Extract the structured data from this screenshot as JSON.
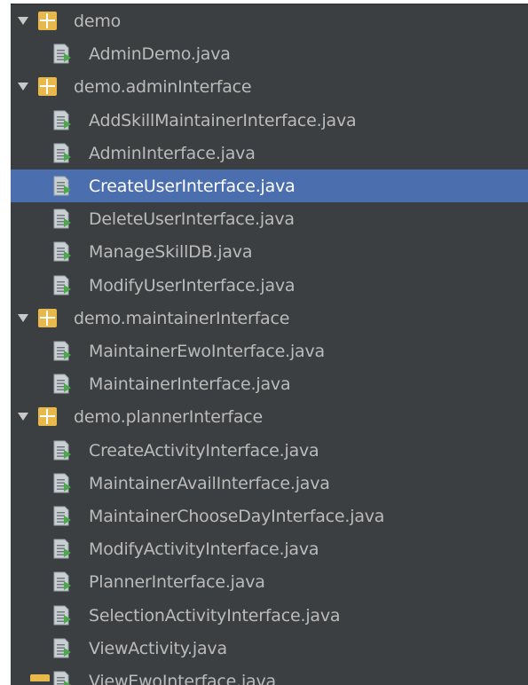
{
  "project_tree": {
    "rows": [
      {
        "type": "package",
        "label": "demo"
      },
      {
        "type": "file",
        "label": "AdminDemo.java"
      },
      {
        "type": "package",
        "label": "demo.adminInterface"
      },
      {
        "type": "file",
        "label": "AddSkillMaintainerInterface.java"
      },
      {
        "type": "file",
        "label": "AdminInterface.java"
      },
      {
        "type": "file",
        "label": "CreateUserInterface.java",
        "selected": true
      },
      {
        "type": "file",
        "label": "DeleteUserInterface.java"
      },
      {
        "type": "file",
        "label": "ManageSkillDB.java"
      },
      {
        "type": "file",
        "label": "ModifyUserInterface.java"
      },
      {
        "type": "package",
        "label": "demo.maintainerInterface"
      },
      {
        "type": "file",
        "label": "MaintainerEwoInterface.java"
      },
      {
        "type": "file",
        "label": "MaintainerInterface.java"
      },
      {
        "type": "package",
        "label": "demo.plannerInterface"
      },
      {
        "type": "file",
        "label": "CreateActivityInterface.java"
      },
      {
        "type": "file",
        "label": "MaintainerAvailInterface.java"
      },
      {
        "type": "file",
        "label": "MaintainerChooseDayInterface.java"
      },
      {
        "type": "file",
        "label": "ModifyActivityInterface.java"
      },
      {
        "type": "file",
        "label": "PlannerInterface.java"
      },
      {
        "type": "file",
        "label": "SelectionActivityInterface.java"
      },
      {
        "type": "file",
        "label": "ViewActivity.java"
      },
      {
        "type": "file",
        "label": "ViewEwoInterface.java"
      }
    ]
  },
  "icons": {
    "package": "package-folder-icon",
    "file": "java-source-file-icon",
    "expanded": "expanded-arrow-icon"
  },
  "colors": {
    "panel_background": "#3c3f41",
    "text": "#bbbbbb",
    "selection": "#4b6eaf",
    "package_icon": "#e8b94a",
    "file_icon": "#c8d0d4",
    "file_icon_accent": "#4ca84c"
  }
}
